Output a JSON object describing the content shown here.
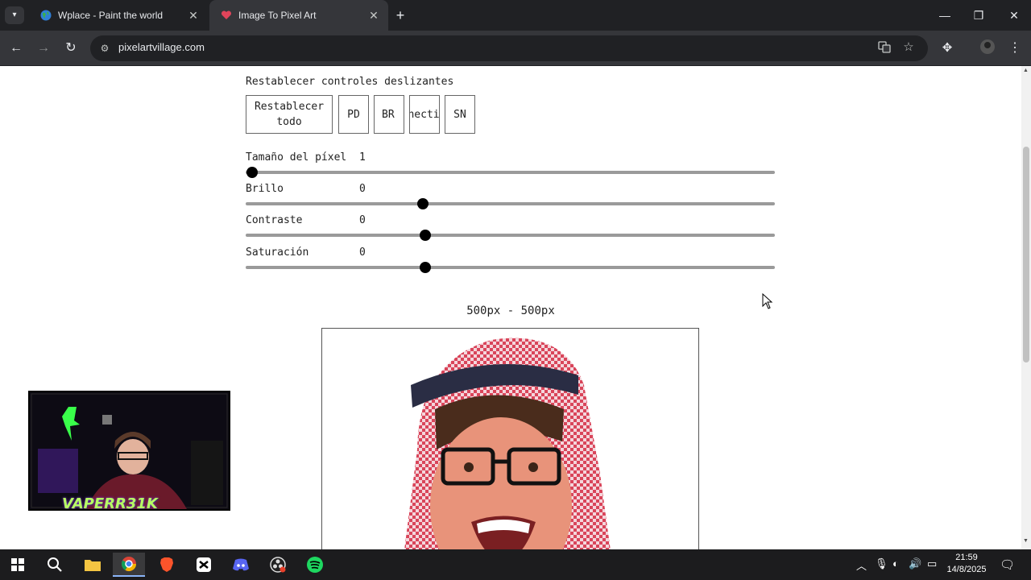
{
  "browser": {
    "tabs": [
      {
        "title": "Wplace - Paint the world",
        "active": false,
        "favicon": "globe-icon"
      },
      {
        "title": "Image To Pixel Art",
        "active": true,
        "favicon": "heart-icon"
      }
    ],
    "url": "pixelartvillage.com"
  },
  "controls": {
    "reset_sliders_label": "Restablecer controles deslizantes",
    "buttons": [
      {
        "label": "Restablecer todo"
      },
      {
        "label": "PD"
      },
      {
        "label": "BR"
      },
      {
        "label": "Connecticut"
      },
      {
        "label": "SN"
      }
    ],
    "sliders": [
      {
        "label": "Tamaño del píxel",
        "value": "1",
        "fraction": 0.0
      },
      {
        "label": "Brillo",
        "value": "0",
        "fraction": 0.33
      },
      {
        "label": "Contraste",
        "value": "0",
        "fraction": 0.335
      },
      {
        "label": "Saturación",
        "value": "0",
        "fraction": 0.335
      }
    ]
  },
  "preview": {
    "size_label": "500px - 500px"
  },
  "overlay": {
    "streamer_name": "VAPERR31K"
  },
  "taskbar": {
    "time": "21:59",
    "date": "14/8/2025"
  },
  "colors": {
    "accent_green": "#b7ff63",
    "chrome_dark": "#202124"
  }
}
